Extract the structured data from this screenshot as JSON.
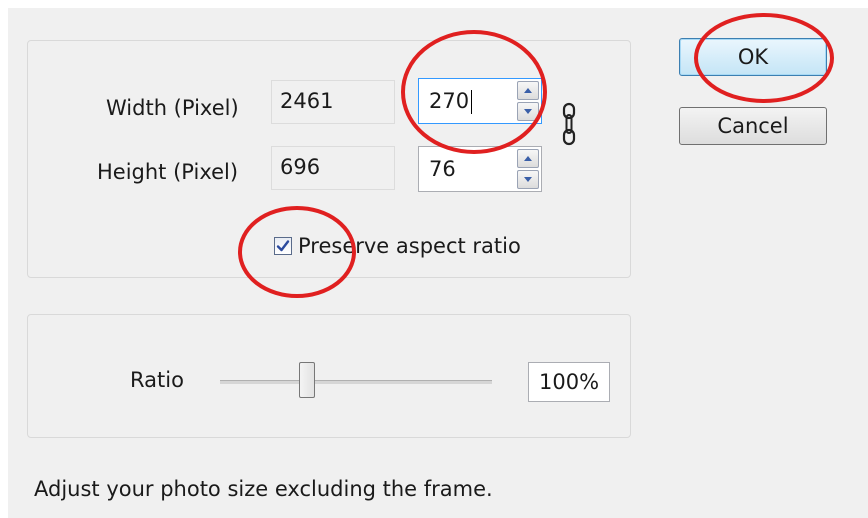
{
  "dialog": {
    "size": {
      "width_label": "Width (Pixel)",
      "height_label": "Height (Pixel)",
      "original_width": "2461",
      "original_height": "696",
      "new_width": "270",
      "new_height": "76",
      "preserve_label": "Preserve aspect ratio",
      "preserve_checked": true
    },
    "ratio": {
      "label": "Ratio",
      "value_text": "100%",
      "slider_level_fraction": 0.32
    },
    "buttons": {
      "ok_label": "OK",
      "cancel_label": "Cancel"
    },
    "hint": "Adjust your photo size excluding the frame."
  },
  "colors": {
    "annotation": "#e02020",
    "checkmark": "#2b4a9e",
    "default_button_border": "#3c7fb1"
  },
  "icons": {
    "chain": "link-chain-icon",
    "spin_up": "triangle-up",
    "spin_down": "triangle-down"
  }
}
